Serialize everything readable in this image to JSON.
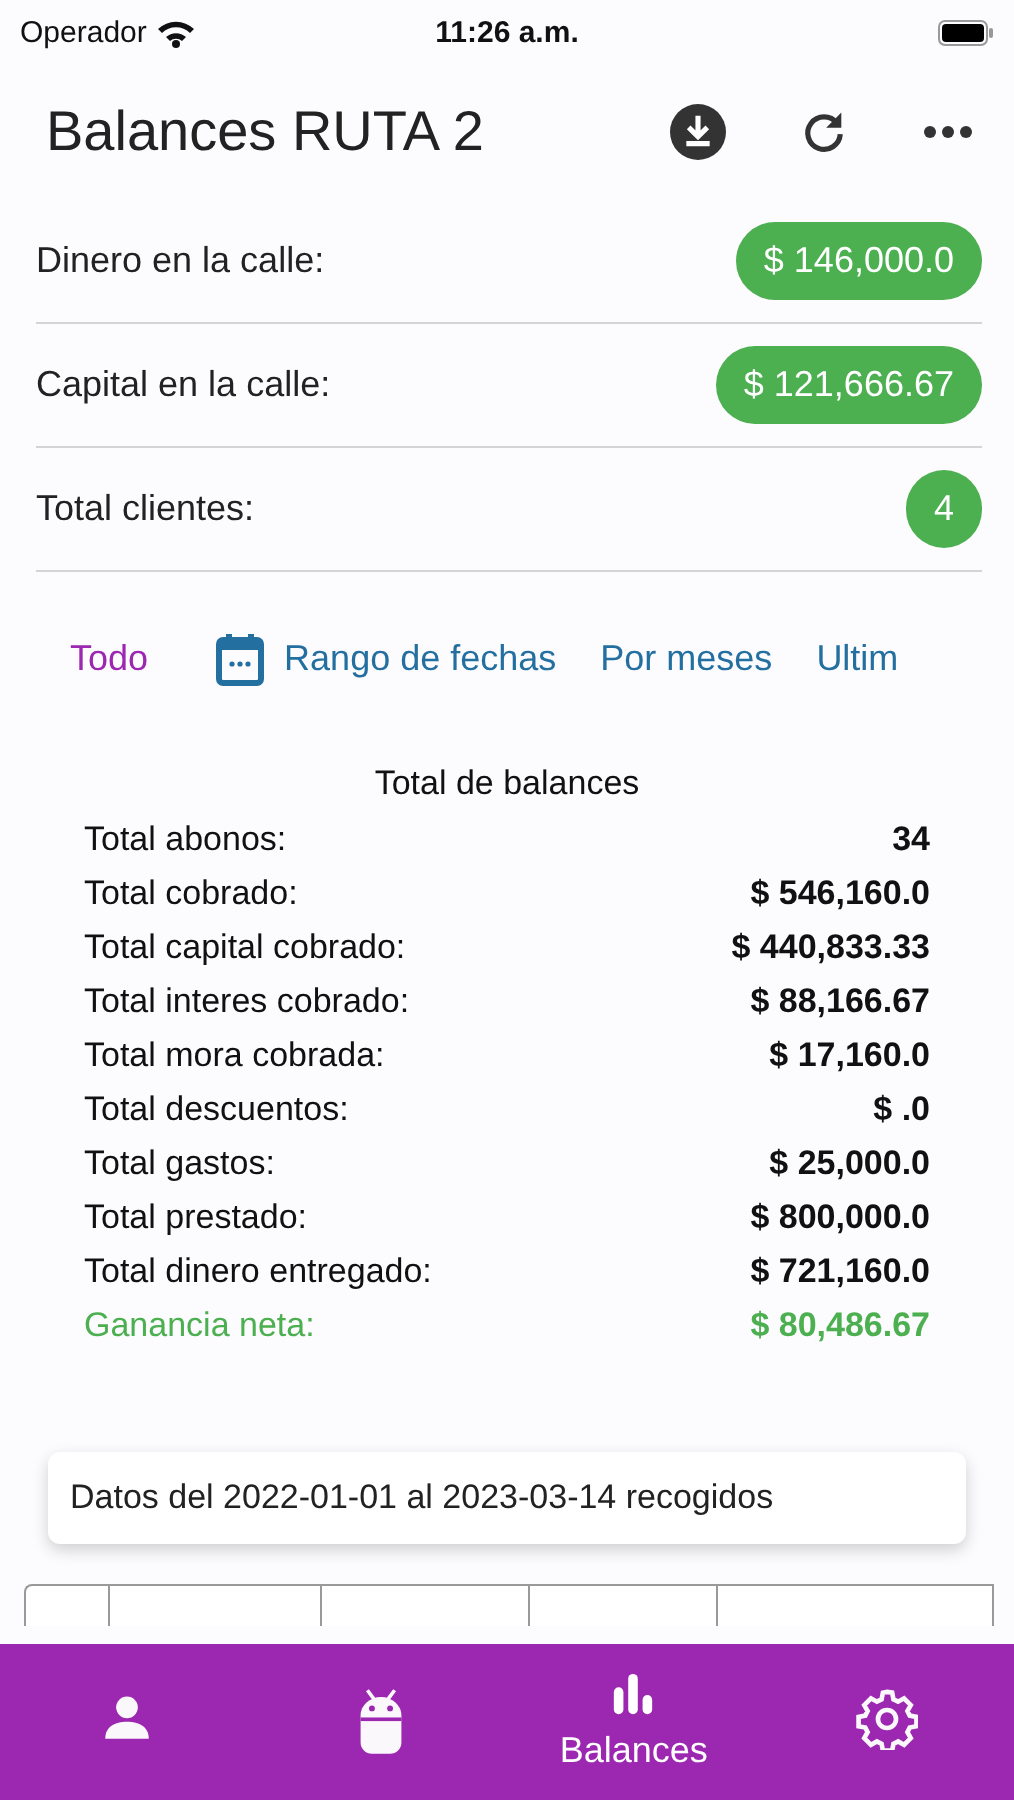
{
  "status_bar": {
    "carrier": "Operador",
    "time": "11:26 a.m."
  },
  "app_bar": {
    "title": "Balances RUTA 2",
    "actions": [
      {
        "kind": "download"
      },
      {
        "kind": "refresh"
      },
      {
        "kind": "more"
      }
    ]
  },
  "stats": [
    {
      "label": "Dinero en la calle:",
      "value": "$ 146,000.0"
    },
    {
      "label": "Capital en la calle:",
      "value": "$ 121,666.67"
    },
    {
      "label": "Total clientes:",
      "value": "4"
    }
  ],
  "filters": [
    {
      "label": "Todo",
      "selected": true,
      "kind": "plain"
    },
    {
      "label": "Rango de fechas",
      "selected": false,
      "kind": "calendar"
    },
    {
      "label": "Por meses",
      "selected": false,
      "kind": "plain"
    },
    {
      "label": "Ultim",
      "selected": false,
      "kind": "plain"
    }
  ],
  "balances": {
    "title": "Total de balances",
    "rows": [
      {
        "label": "Total abonos:",
        "value": "34",
        "kind": "normal"
      },
      {
        "label": "Total cobrado:",
        "value": "$ 546,160.0",
        "kind": "normal"
      },
      {
        "label": "Total capital cobrado:",
        "value": "$ 440,833.33",
        "kind": "normal"
      },
      {
        "label": "Total interes cobrado:",
        "value": "$ 88,166.67",
        "kind": "normal"
      },
      {
        "label": "Total mora cobrada:",
        "value": "$ 17,160.0",
        "kind": "normal"
      },
      {
        "label": "Total descuentos:",
        "value": "$ .0",
        "kind": "normal"
      },
      {
        "label": "Total gastos:",
        "value": "$ 25,000.0",
        "kind": "normal"
      },
      {
        "label": "Total prestado:",
        "value": "$ 800,000.0",
        "kind": "normal"
      },
      {
        "label": "Total dinero entregado:",
        "value": "$ 721,160.0",
        "kind": "normal"
      },
      {
        "label": "Ganancia neta:",
        "value": "$ 80,486.67",
        "kind": "profit"
      }
    ]
  },
  "range_note": "Datos del 2022-01-01 al 2023-03-14 recogidos",
  "bottom_nav": [
    {
      "kind": "person",
      "selected": false
    },
    {
      "kind": "robot",
      "selected": false
    },
    {
      "kind": "chart",
      "selected": true,
      "label": "Balances"
    },
    {
      "kind": "gear",
      "selected": false
    }
  ]
}
